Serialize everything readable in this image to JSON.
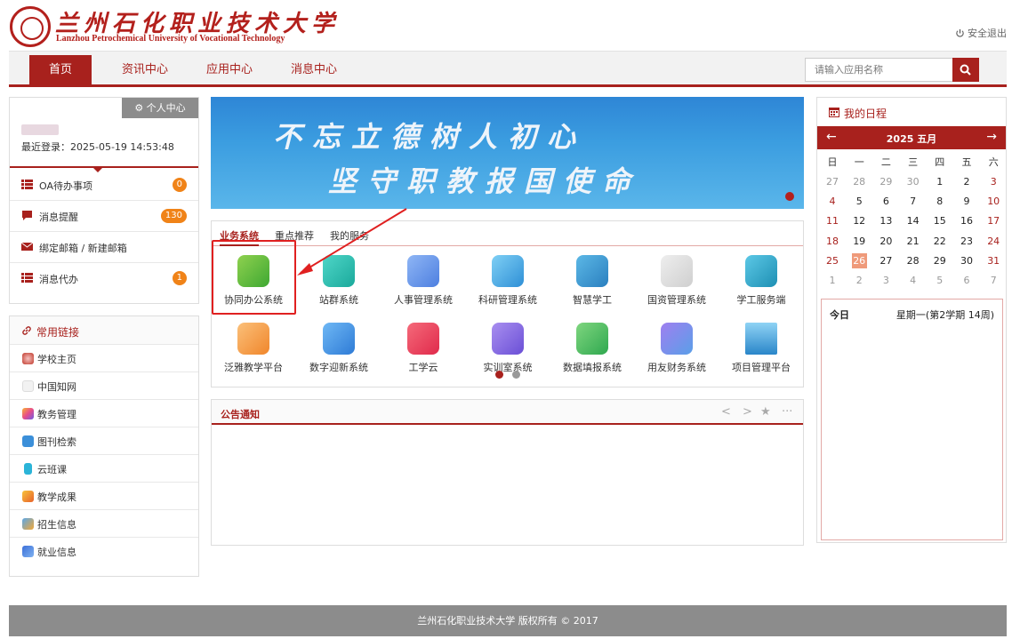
{
  "header": {
    "school_cn": "兰州石化职业技术大学",
    "school_en": "Lanzhou Petrochemical University of Vocational Technology",
    "logout": "安全退出"
  },
  "nav": {
    "items": [
      "首页",
      "资讯中心",
      "应用中心",
      "消息中心"
    ],
    "search_placeholder": "请输入应用名称",
    "accent": "#a8211d"
  },
  "user": {
    "center_btn": "个人中心",
    "last_login": "最近登录：2025-05-19 14:53:48",
    "rows": [
      {
        "label": "OA待办事项",
        "badge": "0"
      },
      {
        "label": "消息提醒",
        "badge": "130"
      },
      {
        "label": "绑定邮箱 / 新建邮箱",
        "badge": ""
      },
      {
        "label": "消息代办",
        "badge": "1"
      }
    ]
  },
  "links": {
    "title": "常用链接",
    "items": [
      "学校主页",
      "中国知网",
      "教务管理",
      "图刊检索",
      "云班课",
      "教学成果",
      "招生信息",
      "就业信息"
    ]
  },
  "banner": {
    "line1": "不忘立德树人初心",
    "line2": "坚守职教报国使命"
  },
  "business": {
    "tabs": [
      "业务系统",
      "重点推荐",
      "我的服务"
    ],
    "apps_row1": [
      "协同办公系统",
      "站群系统",
      "人事管理系统",
      "科研管理系统",
      "智慧学工",
      "国资管理系统",
      "学工服务端"
    ],
    "apps_row2": [
      "泛雅教学平台",
      "数字迎新系统",
      "工学云",
      "实训室系统",
      "数据填报系统",
      "用友财务系统",
      "项目管理平台"
    ]
  },
  "notice": {
    "title": "公告通知",
    "controls": [
      "<",
      ">",
      "★",
      "···"
    ]
  },
  "calendar": {
    "title": "我的日程",
    "month_label": "2025 五月",
    "prev": "←",
    "next": "→",
    "weekdays": [
      "日",
      "一",
      "二",
      "三",
      "四",
      "五",
      "六"
    ],
    "weeks": [
      [
        "27",
        "28",
        "29",
        "30",
        "1",
        "2",
        "3"
      ],
      [
        "4",
        "5",
        "6",
        "7",
        "8",
        "9",
        "10"
      ],
      [
        "11",
        "12",
        "13",
        "14",
        "15",
        "16",
        "17"
      ],
      [
        "18",
        "19",
        "20",
        "21",
        "22",
        "23",
        "24"
      ],
      [
        "25",
        "26",
        "27",
        "28",
        "29",
        "30",
        "31"
      ],
      [
        "1",
        "2",
        "3",
        "4",
        "5",
        "6",
        "7"
      ]
    ],
    "today_value": "26",
    "detail_today": "今日",
    "detail_week": "星期一(第2学期 14周)"
  },
  "footer": {
    "text": "兰州石化职业技术大学 版权所有 © 2017"
  }
}
